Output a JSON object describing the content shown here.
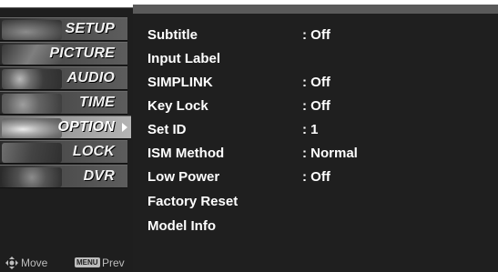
{
  "sidebar": {
    "items": [
      {
        "label": "SETUP",
        "active": false
      },
      {
        "label": "PICTURE",
        "active": false
      },
      {
        "label": "AUDIO",
        "active": false
      },
      {
        "label": "TIME",
        "active": false
      },
      {
        "label": "OPTION",
        "active": true
      },
      {
        "label": "LOCK",
        "active": false
      },
      {
        "label": "DVR",
        "active": false
      }
    ]
  },
  "footer": {
    "move_label": "Move",
    "menu_key": "MENU",
    "prev_label": "Prev"
  },
  "options": [
    {
      "label": "Subtitle",
      "value": ": Off"
    },
    {
      "label": "Input Label",
      "value": ""
    },
    {
      "label": "SIMPLINK",
      "value": ": Off"
    },
    {
      "label": "Key Lock",
      "value": ": Off"
    },
    {
      "label": "Set ID",
      "value": ": 1"
    },
    {
      "label": "ISM Method",
      "value": ": Normal"
    },
    {
      "label": "Low Power",
      "value": ": Off"
    },
    {
      "label": "Factory Reset",
      "value": ""
    },
    {
      "label": "Model Info",
      "value": ""
    }
  ],
  "colors": {
    "panel_bg": "#1f1f1f",
    "sidebar_bg": "#1e1e1e",
    "text": "#ffffff"
  }
}
